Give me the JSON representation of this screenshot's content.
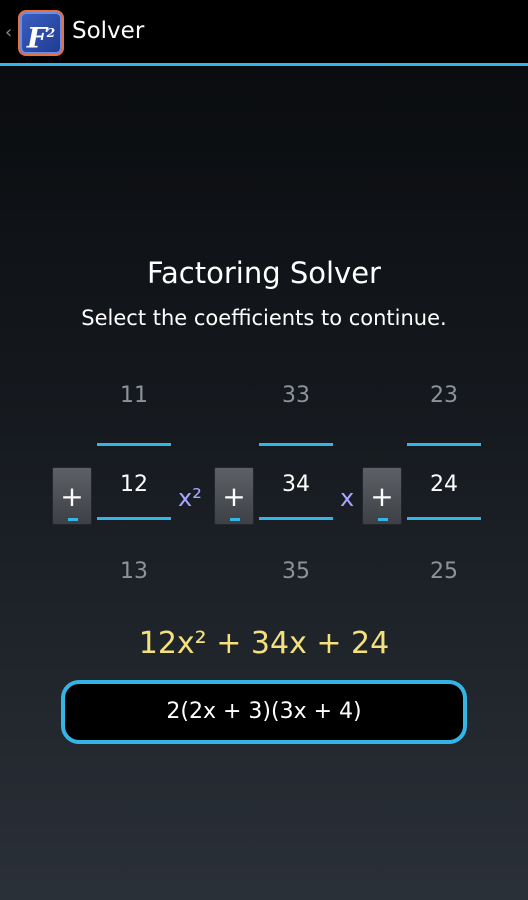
{
  "actionbar": {
    "up_caret": "‹",
    "app_icon_letter": "F",
    "app_icon_sup": "2",
    "title": "Solver"
  },
  "main": {
    "heading": "Factoring Solver",
    "subheading": "Select the coefficients to continue."
  },
  "pickers": {
    "a": {
      "prev": "11",
      "current": "12",
      "next": "13"
    },
    "b": {
      "prev": "33",
      "current": "34",
      "next": "35"
    },
    "c": {
      "prev": "23",
      "current": "24",
      "next": "25"
    }
  },
  "buttons": {
    "plus_label": "+"
  },
  "labels": {
    "x_squared": "x²",
    "x": "x"
  },
  "equation": "12x² + 34x + 24",
  "result": "2(2x + 3)(3x + 4)",
  "colors": {
    "accent": "#33b5e5",
    "equation": "#f4e17c",
    "variable": "#a9a6ff",
    "app_icon_border": "#e8703a"
  }
}
